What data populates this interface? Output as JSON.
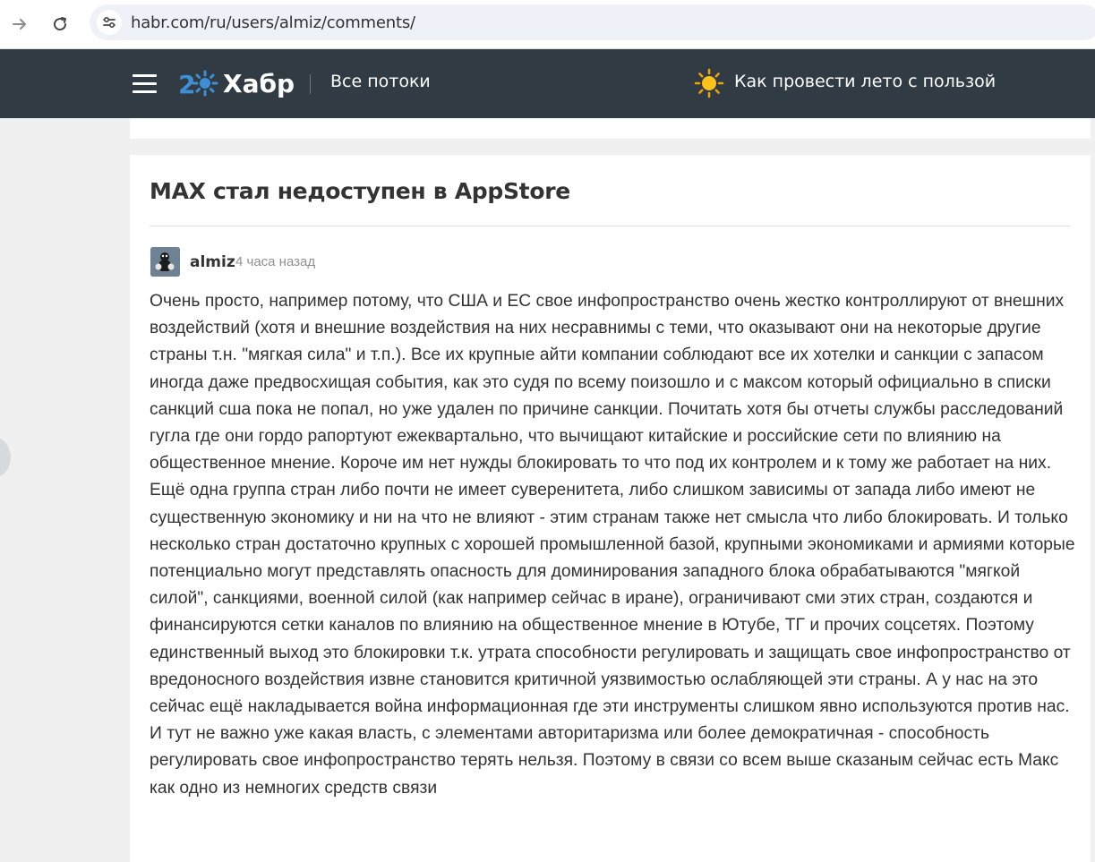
{
  "browser": {
    "url": "habr.com/ru/users/almiz/comments/"
  },
  "header": {
    "logo_text": "Хабр",
    "flows_label": "Все потоки",
    "promo_label": "Как провести лето с пользой"
  },
  "post": {
    "title": "MAX стал недоступен в AppStore"
  },
  "comment": {
    "author": "almiz",
    "time": "4 часа назад",
    "text": "Очень просто, например потому, что США и ЕС свое инфопространство очень жестко контроллируют от внешних воздействий (хотя и внешние воздействия на них несравнимы с теми, что оказывают они на некоторые другие страны т.н. \"мягкая сила\" и т.п.). Все их крупные айти компании соблюдают все их хотелки и санкции с запасом иногда даже предвосхищая события, как это судя по всему поизошло и с максом который официально в списки санкций сша пока не попал, но уже удален по причине санкции. Почитать хотя бы отчеты службы расследований гугла где они гордо рапортуют ежеквартально, что вычищают китайские и российские сети по влиянию на общественное мнение. Короче им нет нужды блокировать то что под их контролем и к тому же работает на них. Ещё одна группа стран либо почти не имеет суверенитета, либо слишком зависимы от запада либо имеют не существенную экономику и ни на что не влияют - этим странам также нет смысла что либо блокировать. И только несколько стран достаточно крупных с хорошей промышленной базой, крупными экономиками и армиями которые потенциально могут представлять опасность для доминирования западного блока обрабатываются \"мягкой силой\", санкциями, военной силой (как например сейчас в иране), ограничивают сми этих стран, создаются и финансируются сетки каналов по влиянию на общественное мнение в Ютубе, ТГ и прочих соцсетях. Поэтому единственный выход это блокировки т.к. утрата способности регулировать и защищать свое инфопространство от вредоносного воздействия извне становится критичной уязвимостью ослабляющей эти страны. А у нас на это сейчас ещё накладывается война информационная где эти инструменты слишком явно используются против нас. И тут не важно уже какая власть, с элементами авторитаризма или более демократичная - способность регулировать свое инфопространство терять нельзя. Поэтому в связи со всем выше сказаным сейчас есть Макс как одно из немногих средств связи"
  },
  "colors": {
    "header_bg": "#303b44",
    "page_bg": "#f0f0f0",
    "logo_blue": "#3e8fd6"
  },
  "icons": [
    "forward-arrow-icon",
    "reload-icon",
    "site-info-icon",
    "menu-icon",
    "sun-icon"
  ]
}
